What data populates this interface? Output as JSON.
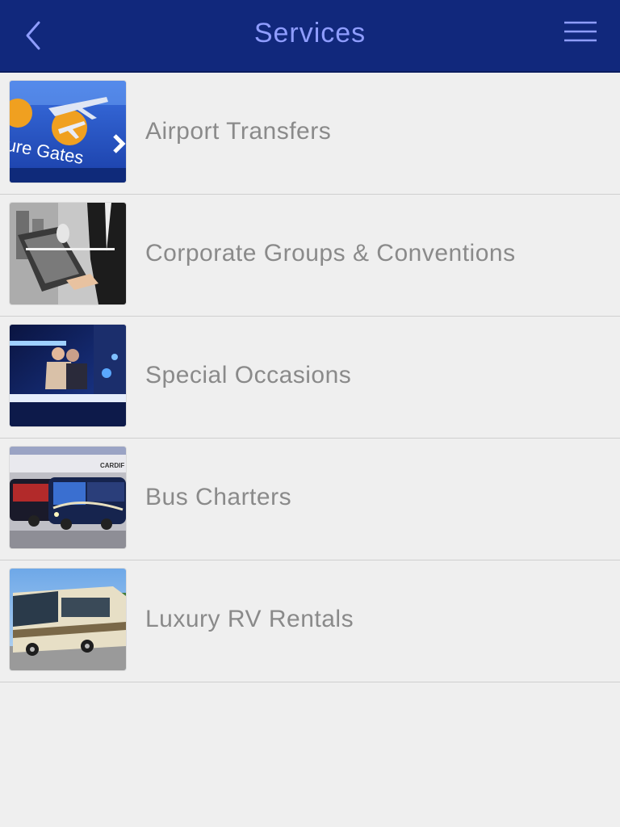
{
  "header": {
    "title": "Services",
    "back_icon": "chevron-left-icon",
    "menu_icon": "hamburger-menu-icon",
    "background_color": "#11287c",
    "title_color": "#8f9dff"
  },
  "services": [
    {
      "label": "Airport Transfers",
      "image": "airport-departure-gates-thumbnail",
      "sign_text": "ure Gates"
    },
    {
      "label": "Corporate Groups & Conventions",
      "image": "business-laptop-thumbnail"
    },
    {
      "label": "Special Occasions",
      "image": "limo-party-thumbnail"
    },
    {
      "label": "Bus Charters",
      "image": "party-bus-thumbnail",
      "sign_text": "CARDIF"
    },
    {
      "label": "Luxury RV Rentals",
      "image": "luxury-rv-thumbnail"
    }
  ]
}
